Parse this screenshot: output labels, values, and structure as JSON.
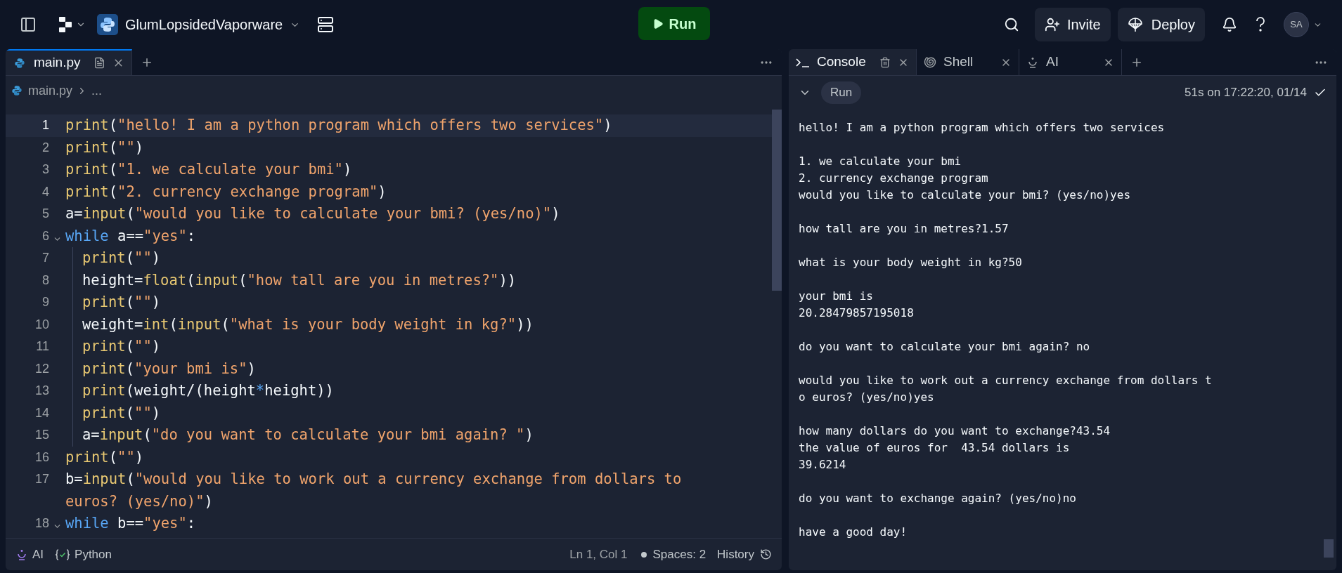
{
  "top_bar": {
    "project_name": "GlumLopsidedVaporware",
    "run_button": "Run",
    "invite_button": "Invite",
    "deploy_button": "Deploy",
    "avatar": "SA"
  },
  "editor": {
    "tabs": [
      {
        "label": "main.py",
        "selected": true
      }
    ],
    "breadcrumb": [
      "main.py",
      "..."
    ],
    "lines": [
      {
        "number": "1",
        "current": true,
        "foldable": false,
        "tokens": [
          {
            "kind": "func",
            "text": "print"
          },
          {
            "kind": "plain",
            "text": "("
          },
          {
            "kind": "str",
            "text": "\"hello! I am a python program which offers two services\""
          },
          {
            "kind": "plain",
            "text": ")"
          }
        ]
      },
      {
        "number": "2",
        "current": false,
        "foldable": false,
        "tokens": [
          {
            "kind": "func",
            "text": "print"
          },
          {
            "kind": "plain",
            "text": "("
          },
          {
            "kind": "str",
            "text": "\"\""
          },
          {
            "kind": "plain",
            "text": ")"
          }
        ]
      },
      {
        "number": "3",
        "current": false,
        "foldable": false,
        "tokens": [
          {
            "kind": "func",
            "text": "print"
          },
          {
            "kind": "plain",
            "text": "("
          },
          {
            "kind": "str",
            "text": "\"1. we calculate your bmi\""
          },
          {
            "kind": "plain",
            "text": ")"
          }
        ]
      },
      {
        "number": "4",
        "current": false,
        "foldable": false,
        "tokens": [
          {
            "kind": "func",
            "text": "print"
          },
          {
            "kind": "plain",
            "text": "("
          },
          {
            "kind": "str",
            "text": "\"2. currency exchange program\""
          },
          {
            "kind": "plain",
            "text": ")"
          }
        ]
      },
      {
        "number": "5",
        "current": false,
        "foldable": false,
        "tokens": [
          {
            "kind": "plain",
            "text": "a="
          },
          {
            "kind": "func",
            "text": "input"
          },
          {
            "kind": "plain",
            "text": "("
          },
          {
            "kind": "str",
            "text": "\"would you like to calculate your bmi? (yes/no)\""
          },
          {
            "kind": "plain",
            "text": ")"
          }
        ]
      },
      {
        "number": "6",
        "current": false,
        "foldable": true,
        "tokens": [
          {
            "kind": "kw",
            "text": "while"
          },
          {
            "kind": "plain",
            "text": " a=="
          },
          {
            "kind": "str",
            "text": "\"yes\""
          },
          {
            "kind": "plain",
            "text": ":"
          }
        ],
        "children": [
          {
            "number": "7",
            "current": false,
            "foldable": false,
            "tokens": [
              {
                "kind": "func",
                "text": "print"
              },
              {
                "kind": "plain",
                "text": "("
              },
              {
                "kind": "str",
                "text": "\"\""
              },
              {
                "kind": "plain",
                "text": ")"
              }
            ]
          },
          {
            "number": "8",
            "current": false,
            "foldable": false,
            "tokens": [
              {
                "kind": "plain",
                "text": "height="
              },
              {
                "kind": "func",
                "text": "float"
              },
              {
                "kind": "plain",
                "text": "("
              },
              {
                "kind": "func",
                "text": "input"
              },
              {
                "kind": "plain",
                "text": "("
              },
              {
                "kind": "str",
                "text": "\"how tall are you in metres?\""
              },
              {
                "kind": "plain",
                "text": "))"
              }
            ]
          },
          {
            "number": "9",
            "current": false,
            "foldable": false,
            "tokens": [
              {
                "kind": "func",
                "text": "print"
              },
              {
                "kind": "plain",
                "text": "("
              },
              {
                "kind": "str",
                "text": "\"\""
              },
              {
                "kind": "plain",
                "text": ")"
              }
            ]
          },
          {
            "number": "10",
            "current": false,
            "foldable": false,
            "tokens": [
              {
                "kind": "plain",
                "text": "weight="
              },
              {
                "kind": "func",
                "text": "int"
              },
              {
                "kind": "plain",
                "text": "("
              },
              {
                "kind": "func",
                "text": "input"
              },
              {
                "kind": "plain",
                "text": "("
              },
              {
                "kind": "str",
                "text": "\"what is your body weight in kg?\""
              },
              {
                "kind": "plain",
                "text": "))"
              }
            ]
          },
          {
            "number": "11",
            "current": false,
            "foldable": false,
            "tokens": [
              {
                "kind": "func",
                "text": "print"
              },
              {
                "kind": "plain",
                "text": "("
              },
              {
                "kind": "str",
                "text": "\"\""
              },
              {
                "kind": "plain",
                "text": ")"
              }
            ]
          },
          {
            "number": "12",
            "current": false,
            "foldable": false,
            "tokens": [
              {
                "kind": "func",
                "text": "print"
              },
              {
                "kind": "plain",
                "text": "("
              },
              {
                "kind": "str",
                "text": "\"your bmi is\""
              },
              {
                "kind": "plain",
                "text": ")"
              }
            ]
          },
          {
            "number": "13",
            "current": false,
            "foldable": false,
            "tokens": [
              {
                "kind": "func",
                "text": "print"
              },
              {
                "kind": "plain",
                "text": "(weight/(height"
              },
              {
                "kind": "op",
                "text": "*"
              },
              {
                "kind": "plain",
                "text": "height))"
              }
            ]
          },
          {
            "number": "14",
            "current": false,
            "foldable": false,
            "tokens": [
              {
                "kind": "func",
                "text": "print"
              },
              {
                "kind": "plain",
                "text": "("
              },
              {
                "kind": "str",
                "text": "\"\""
              },
              {
                "kind": "plain",
                "text": ")"
              }
            ]
          },
          {
            "number": "15",
            "current": false,
            "foldable": false,
            "tokens": [
              {
                "kind": "plain",
                "text": "a="
              },
              {
                "kind": "func",
                "text": "input"
              },
              {
                "kind": "plain",
                "text": "("
              },
              {
                "kind": "str",
                "text": "\"do you want to calculate your bmi again? \""
              },
              {
                "kind": "plain",
                "text": ")"
              }
            ]
          }
        ]
      },
      {
        "number": "16",
        "current": false,
        "foldable": false,
        "tokens": [
          {
            "kind": "func",
            "text": "print"
          },
          {
            "kind": "plain",
            "text": "("
          },
          {
            "kind": "str",
            "text": "\"\""
          },
          {
            "kind": "plain",
            "text": ")"
          }
        ]
      },
      {
        "number": "17",
        "current": false,
        "foldable": false,
        "tokens": [
          {
            "kind": "plain",
            "text": "b="
          },
          {
            "kind": "func",
            "text": "input"
          },
          {
            "kind": "plain",
            "text": "("
          },
          {
            "kind": "str",
            "text": "\"would you like to work out a currency exchange from dollars to euros? (yes/no)\""
          },
          {
            "kind": "plain",
            "text": ")"
          }
        ]
      },
      {
        "number": "18",
        "current": false,
        "foldable": true,
        "tokens": [
          {
            "kind": "kw",
            "text": "while"
          },
          {
            "kind": "plain",
            "text": " b=="
          },
          {
            "kind": "str",
            "text": "\"yes\""
          },
          {
            "kind": "plain",
            "text": ":"
          }
        ]
      }
    ],
    "status_bar": {
      "ai": "AI",
      "language": "Python",
      "cursor": "Ln 1, Col 1",
      "spaces": "Spaces: 2",
      "history": "History"
    }
  },
  "console": {
    "tabs": [
      {
        "label": "Console",
        "kind": "console",
        "selected": true
      },
      {
        "label": "Shell",
        "kind": "shell",
        "selected": false
      },
      {
        "label": "AI",
        "kind": "ai",
        "selected": false
      }
    ],
    "run_chip": "Run",
    "run_info": "51s on 17:22:20, 01/14",
    "output": [
      [
        "hello! I am a python program which offers two services"
      ],
      [
        "1. we calculate your bmi",
        "2. currency exchange program",
        "would you like to calculate your bmi? (yes/no)yes"
      ],
      [
        "how tall are you in metres?1.57"
      ],
      [
        "what is your body weight in kg?50"
      ],
      [
        "your bmi is",
        "20.28479857195018"
      ],
      [
        "do you want to calculate your bmi again? no"
      ],
      [
        "would you like to work out a currency exchange from dollars t",
        "o euros? (yes/no)yes"
      ],
      [
        "how many dollars do you want to exchange?43.54",
        "the value of euros for  43.54 dollars is",
        "39.6214"
      ],
      [
        "do you want to exchange again? (yes/no)no"
      ],
      [
        "have a good day!"
      ]
    ]
  }
}
